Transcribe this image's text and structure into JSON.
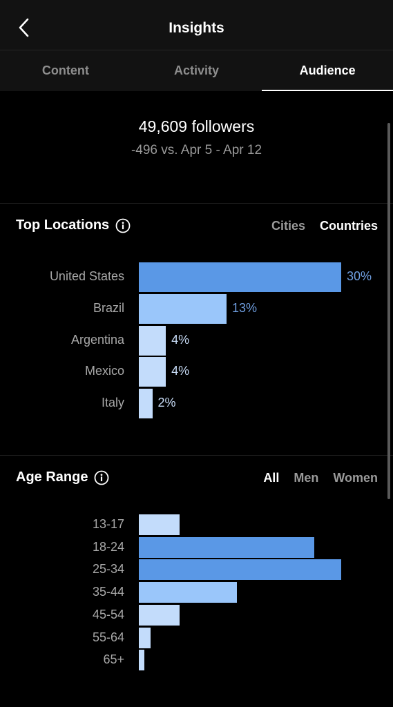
{
  "header": {
    "title": "Insights",
    "back_icon": "chevron-left-icon"
  },
  "tabs": [
    {
      "label": "Content",
      "active": false
    },
    {
      "label": "Activity",
      "active": false
    },
    {
      "label": "Audience",
      "active": true
    }
  ],
  "summary": {
    "followers": "49,609 followers",
    "delta": "-496 vs. Apr 5 - Apr 12"
  },
  "top_locations": {
    "title": "Top Locations",
    "toggle": [
      {
        "label": "Cities",
        "active": false
      },
      {
        "label": "Countries",
        "active": true
      }
    ],
    "items": [
      {
        "label": "United States",
        "value": 30,
        "pct": "30%",
        "color": "#5a98e6"
      },
      {
        "label": "Brazil",
        "value": 13,
        "pct": "13%",
        "color": "#9ac6fa"
      },
      {
        "label": "Argentina",
        "value": 4,
        "pct": "4%",
        "color": "#c3dcfb"
      },
      {
        "label": "Mexico",
        "value": 4,
        "pct": "4%",
        "color": "#c3dcfb"
      },
      {
        "label": "Italy",
        "value": 2,
        "pct": "2%",
        "color": "#c3dcfb"
      }
    ]
  },
  "age_range": {
    "title": "Age Range",
    "toggle": [
      {
        "label": "All",
        "active": true
      },
      {
        "label": "Men",
        "active": false
      },
      {
        "label": "Women",
        "active": false
      }
    ],
    "items": [
      {
        "label": "13-17",
        "value": 6,
        "color": "#c3dcfb"
      },
      {
        "label": "18-24",
        "value": 26,
        "color": "#5a98e6"
      },
      {
        "label": "25-34",
        "value": 30,
        "color": "#5a98e6"
      },
      {
        "label": "35-44",
        "value": 14.5,
        "color": "#9ac6fa"
      },
      {
        "label": "45-54",
        "value": 6,
        "color": "#c3dcfb"
      },
      {
        "label": "55-64",
        "value": 1.7,
        "color": "#c3dcfb"
      },
      {
        "label": "65+",
        "value": 0.8,
        "color": "#c3dcfb"
      }
    ]
  },
  "colors": {
    "accent_blue": "#5a98e6",
    "pct_blue": "#6f9ee0",
    "pct_light": "#c8dcf7"
  }
}
